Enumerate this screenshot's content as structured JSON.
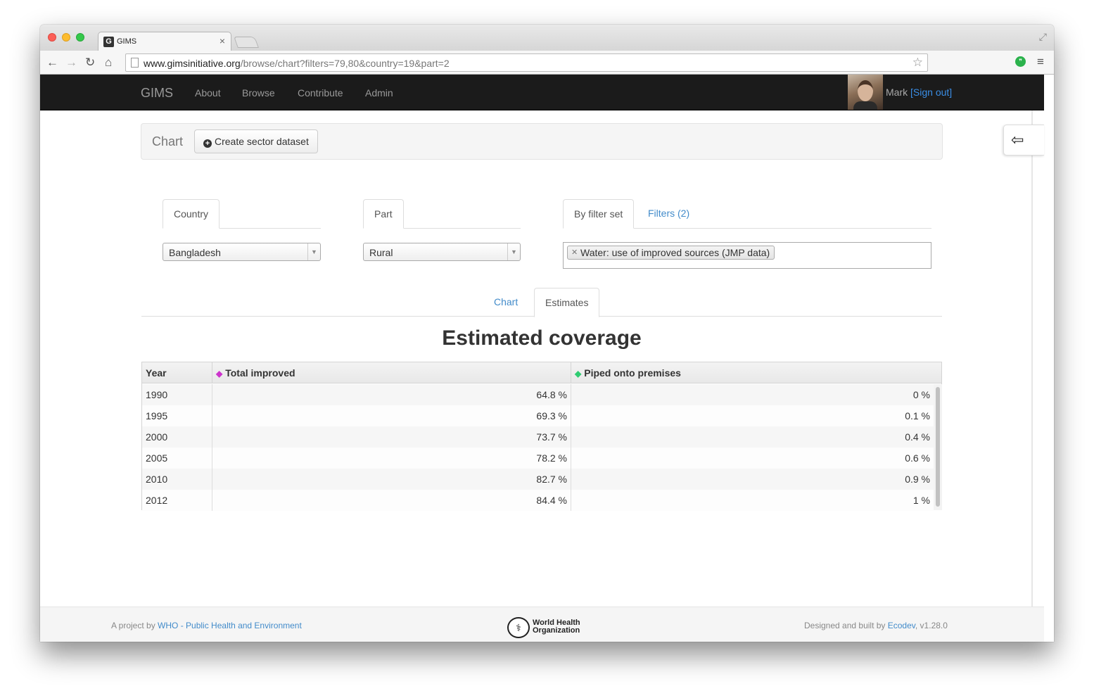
{
  "browser": {
    "tab_title": "GIMS",
    "favicon_letter": "G",
    "url_host": "www.gimsinitiative.org",
    "url_path": "/browse/chart?filters=79,80&country=19&part=2"
  },
  "navbar": {
    "brand": "GIMS",
    "links": [
      "About",
      "Browse",
      "Contribute",
      "Admin"
    ],
    "user_name": "Mark",
    "sign_out": "[Sign out]"
  },
  "header": {
    "title": "Chart",
    "create_button": "Create sector dataset"
  },
  "filters": {
    "country_tab": "Country",
    "country_value": "Bangladesh",
    "part_tab": "Part",
    "part_value": "Rural",
    "filterset_tab": "By filter set",
    "filters_tab": "Filters (2)",
    "selected_filter": "Water: use of improved sources (JMP data)"
  },
  "view_tabs": {
    "chart": "Chart",
    "estimates": "Estimates"
  },
  "estimates": {
    "title": "Estimated coverage",
    "columns": [
      "Year",
      "Total improved",
      "Piped onto premises"
    ],
    "column_colors": {
      "total_improved": "#cc33cc",
      "piped_onto_premises": "#2ecc71"
    },
    "rows": [
      [
        "1990",
        "64.8 %",
        "0 %"
      ],
      [
        "1995",
        "69.3 %",
        "0.1 %"
      ],
      [
        "2000",
        "73.7 %",
        "0.4 %"
      ],
      [
        "2005",
        "78.2 %",
        "0.6 %"
      ],
      [
        "2010",
        "82.7 %",
        "0.9 %"
      ],
      [
        "2012",
        "84.4 %",
        "1 %"
      ]
    ]
  },
  "footer": {
    "left_prefix": "A project by ",
    "left_link": "WHO - Public Health and Environment",
    "logo_line1": "World Health",
    "logo_line2": "Organization",
    "right_prefix": "Designed and built by ",
    "right_link": "Ecodev",
    "version": ", v1.28.0"
  },
  "icons": {
    "add": "plus-circle-icon",
    "sign_in": "sign-in-icon",
    "tag": "tag-icon",
    "remove": "remove-icon"
  }
}
